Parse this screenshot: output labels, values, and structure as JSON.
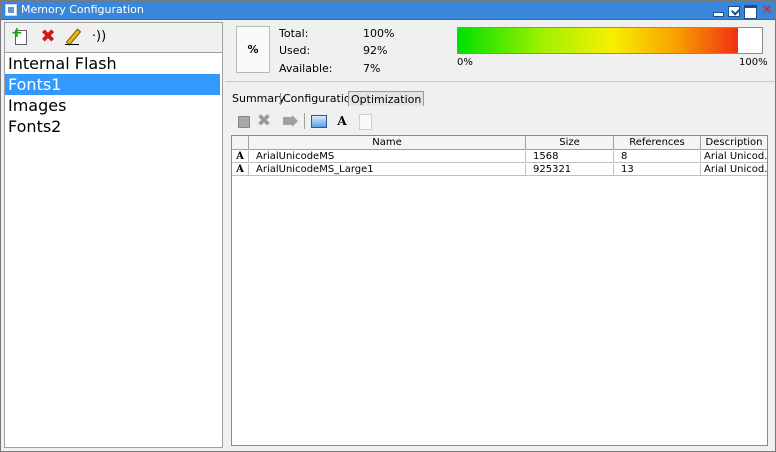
{
  "window": {
    "title": "Memory Configuration",
    "close_glyph": "✕"
  },
  "left": {
    "toolbar": {
      "new_icon": "new-page-icon",
      "delete_icon": "delete-x-icon",
      "delete_glyph": "✖",
      "edit_icon": "pencil-icon",
      "signal_icon": "signal-icon",
      "signal_glyph": "·))"
    },
    "items": [
      {
        "label": "Internal Flash",
        "selected": false
      },
      {
        "label": "Fonts1",
        "selected": true
      },
      {
        "label": "Images",
        "selected": false
      },
      {
        "label": "Fonts2",
        "selected": false
      }
    ]
  },
  "summary": {
    "percent_symbol": "%",
    "total_label": "Total:",
    "total_value": "100%",
    "used_label": "Used:",
    "used_value": "92%",
    "available_label": "Available:",
    "available_value": "7%",
    "bar_min": "0%",
    "bar_max": "100%",
    "used_fraction": 0.92
  },
  "tabs": [
    {
      "label": "Summary",
      "active": false
    },
    {
      "label": "Configuration",
      "active": false
    },
    {
      "label": "Optimization",
      "active": true
    }
  ],
  "content_toolbar": {
    "delete_glyph": "✖",
    "font_glyph": "A"
  },
  "table": {
    "columns": [
      "",
      "Name",
      "Size",
      "References",
      "Description"
    ],
    "rows": [
      {
        "icon_glyph": "A",
        "name": "ArialUnicodeMS",
        "size": "1568",
        "references": "8",
        "description": "Arial Unicod..."
      },
      {
        "icon_glyph": "A",
        "name": "ArialUnicodeMS_Large1",
        "size": "925321",
        "references": "13",
        "description": "Arial Unicod..."
      }
    ]
  },
  "colors": {
    "titlebar": "#3a86d8",
    "selection": "#3399ff"
  }
}
